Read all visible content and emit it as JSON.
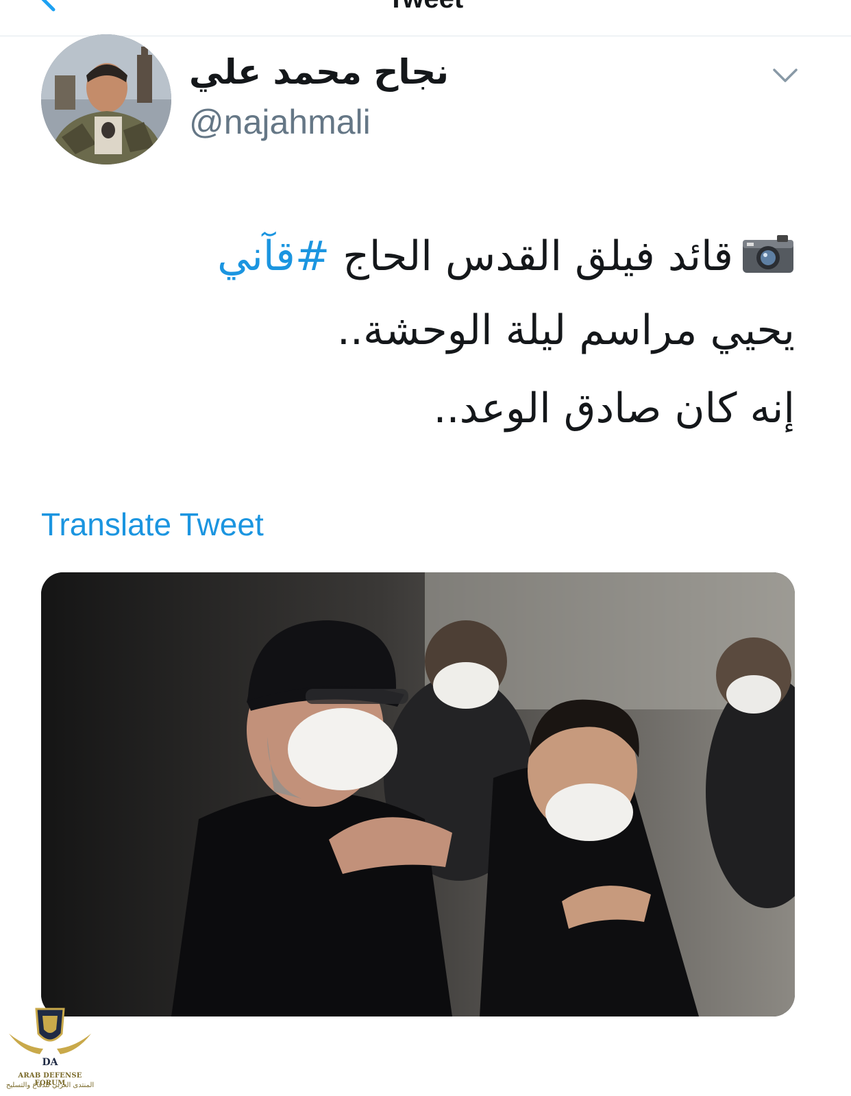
{
  "header": {
    "title": "Tweet"
  },
  "author": {
    "display_name": "نجاح محمد علي",
    "handle": "@najahmali"
  },
  "tweet": {
    "line1_text": "قائد فيلق القدس الحاج ",
    "line1_hashtag": "#قآني",
    "line2_text": "يحيي مراسم ليلة الوحشة..",
    "line3_text": "إنه كان صادق الوعد.."
  },
  "translate_label": "Translate Tweet",
  "watermark": {
    "logo_text": "DA",
    "name_en": "ARAB DEFENSE FORUM",
    "name_ar": "المنتدى العربي للدفاع والتسليح"
  },
  "colors": {
    "link": "#1b95e0",
    "handle": "#657786",
    "divider": "#e1e8ed"
  },
  "icons": [
    "back-arrow-icon",
    "chevron-down-icon",
    "camera-icon"
  ]
}
